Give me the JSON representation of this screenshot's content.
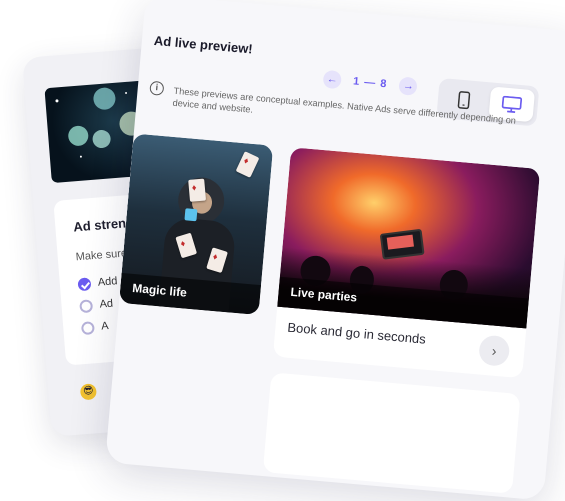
{
  "back_panel": {
    "strength_title": "Ad streng",
    "hint": "Make sure",
    "checklist": [
      {
        "label": "Add",
        "checked": true
      },
      {
        "label": "Ad",
        "checked": false
      },
      {
        "label": "A",
        "checked": false
      }
    ],
    "emoji": "😎"
  },
  "preview": {
    "title": "Ad live preview!",
    "pager": {
      "prev_icon": "arrow-left-icon",
      "range_start": "1",
      "separator": "—",
      "range_end": "8",
      "next_icon": "arrow-right-icon"
    },
    "device_toggle": {
      "options": [
        "phone",
        "desktop"
      ],
      "selected": "desktop"
    },
    "info_text": "These previews are conceptual examples. Native Ads serve differently depending on device and website.",
    "cards": [
      {
        "caption": "Magic life"
      },
      {
        "caption": "Live parties",
        "body": "Book and go in seconds",
        "action_icon": "chevron-right-icon"
      }
    ]
  },
  "colors": {
    "accent": "#6b5cf0",
    "panel_bg": "#f7f7fa",
    "card_bg": "#ffffff"
  }
}
